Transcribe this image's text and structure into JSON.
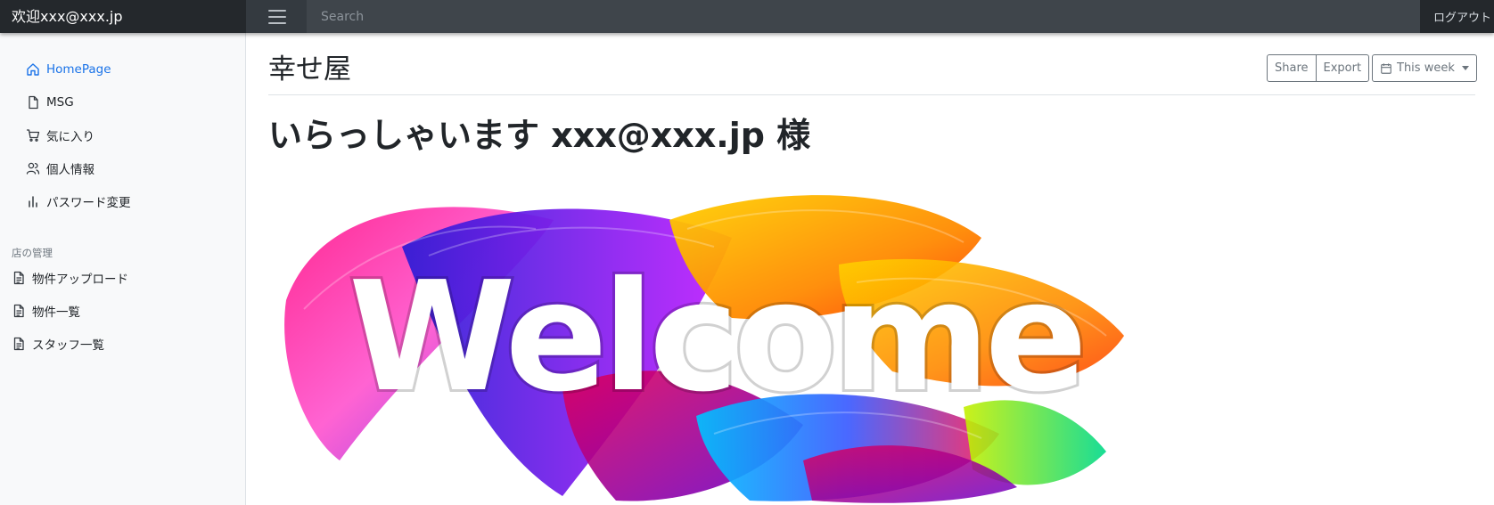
{
  "navbar": {
    "brand": "欢迎xxx@xxx.jp",
    "search_placeholder": "Search",
    "logout": "ログアウト"
  },
  "sidebar": {
    "items": [
      {
        "label": "HomePage",
        "icon": "home-icon",
        "active": true
      },
      {
        "label": "MSG",
        "icon": "file-icon"
      },
      {
        "label": "気に入り",
        "icon": "cart-icon"
      },
      {
        "label": "個人情報",
        "icon": "users-icon"
      },
      {
        "label": "パスワード変更",
        "icon": "bar-chart-icon"
      }
    ],
    "section_heading": "店の管理",
    "section_items": [
      {
        "label": "物件アップロード",
        "icon": "file-text-icon"
      },
      {
        "label": "物件一覧",
        "icon": "file-text-icon"
      },
      {
        "label": "スタッフ一覧",
        "icon": "file-text-icon"
      }
    ]
  },
  "main": {
    "title": "幸せ屋",
    "toolbar": {
      "share": "Share",
      "export": "Export",
      "period": "This week",
      "period_icon": "calendar-icon"
    },
    "greeting": "いらっしゃいます xxx@xxx.jp 様",
    "banner": {
      "word": "Welcome",
      "colors": [
        "#ff1e8c",
        "#7a2cf0",
        "#ffb300",
        "#ff6a00",
        "#00c2ff",
        "#c6f000",
        "#e0005a"
      ]
    }
  }
}
